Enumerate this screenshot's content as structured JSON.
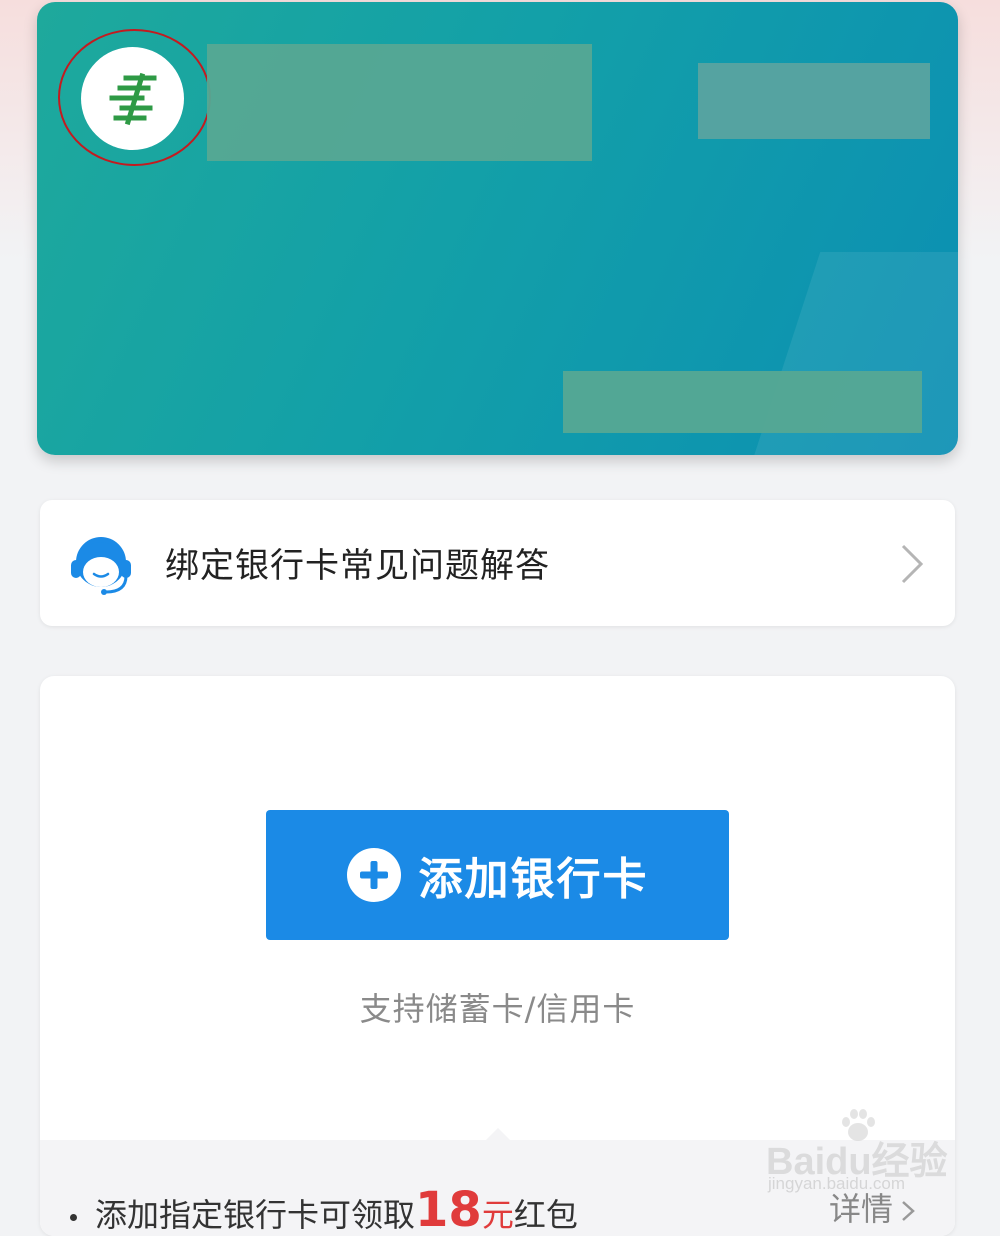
{
  "card": {
    "logo_icon": "postal-savings-bank-logo-icon",
    "brand_color": "#1ea99c"
  },
  "faq": {
    "icon": "customer-service-icon",
    "label": "绑定银行卡常见问题解答",
    "chevron_icon": "chevron-right-icon"
  },
  "add_card": {
    "button_icon": "plus-circle-icon",
    "button_label": "添加银行卡",
    "support_text": "支持储蓄卡/信用卡",
    "accent_color": "#1b8ae6"
  },
  "promo": {
    "text_before": "添加指定银行卡可领取",
    "amount": "18",
    "unit": "元",
    "text_after": "红包",
    "details_label": "详情",
    "highlight_color": "#e03b3b"
  },
  "watermark": {
    "main": "Baidu经验",
    "sub": "jingyan.baidu.com"
  }
}
